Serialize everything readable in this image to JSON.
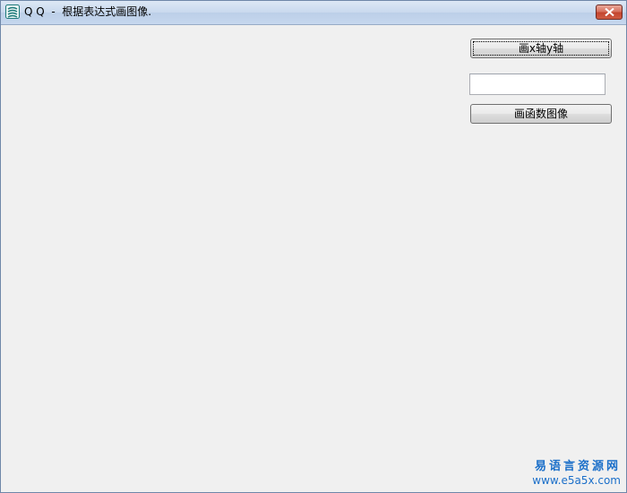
{
  "window": {
    "title": "Q Q  -  根据表达式画图像.",
    "icon": "app-logo-icon"
  },
  "controls": {
    "draw_axes_label": "画x轴y轴",
    "expression_value": "",
    "draw_function_label": "画函数图像"
  },
  "watermark": {
    "line1": "易语言资源网",
    "line2": "www.e5a5x.com"
  },
  "colors": {
    "titlebar": "#c9d9ee",
    "client_background": "#f0f0f0",
    "close_button": "#c4452e",
    "watermark": "#1b6fc9"
  }
}
